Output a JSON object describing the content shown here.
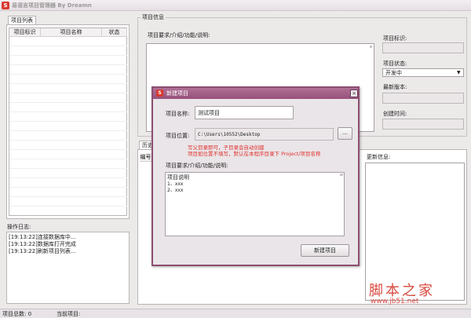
{
  "window": {
    "title": "易语言项目管理器 By Dreamn",
    "icon_letter": "S"
  },
  "project_list": {
    "tab_label": "项目列表",
    "columns": [
      "项目标识",
      "项目名称",
      "状态"
    ]
  },
  "operation_log": {
    "label": "操作日志:",
    "lines": [
      "[19:13:22]连接数据库中...",
      "[19:13:22]数据库打开完成",
      "[19:13:22]刷新项目列表..."
    ]
  },
  "project_info": {
    "legend": "项目信息",
    "requirement_label": "项目要求/介绍/功能/说明:",
    "id_label": "项目标识:",
    "status_label": "项目状态:",
    "status_value": "开发中",
    "latest_version_label": "最新版本:",
    "created_label": "创建时间:"
  },
  "history": {
    "tab_label": "历史",
    "column_partial": "编号",
    "update_label": "更新信息:"
  },
  "dialog": {
    "title": "新建项目",
    "close_glyph": "×",
    "name_label": "项目名称:",
    "name_value": "测试项目",
    "location_label": "项目位置:",
    "location_value": "C:\\Users\\10552\\Desktop",
    "browse_label": "...",
    "note_line1": "写父目录即可，子目录会自动创建",
    "note_line2": "项目如位置不填写，默认在本程序目录下 Project/项目名称",
    "requirement_label": "项目要求/介绍/功能/说明:",
    "requirement_lines": [
      "项目说明",
      "1、xxx",
      "2、xxx"
    ],
    "create_button": "新建项目"
  },
  "status_bar": {
    "total_label": "项目总数: 0",
    "current_label": "当前项目:"
  },
  "watermark": {
    "cn": "脚本之家",
    "url": "www.jb51.net"
  },
  "colors": {
    "dialog_title": "#96517a",
    "note_red": "#e0312d",
    "app_icon": "#d9392f"
  }
}
